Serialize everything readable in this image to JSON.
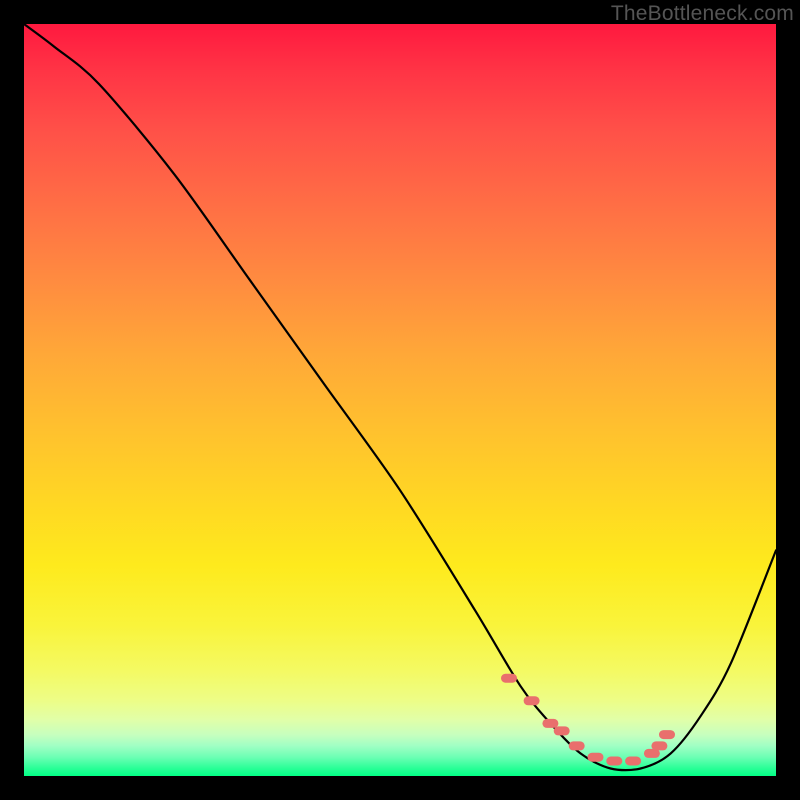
{
  "watermark": "TheBottleneck.com",
  "chart_data": {
    "type": "line",
    "title": "",
    "xlabel": "",
    "ylabel": "",
    "xlim": [
      0,
      100
    ],
    "ylim": [
      0,
      100
    ],
    "series": [
      {
        "name": "bottleneck-curve",
        "x": [
          0,
          4,
          10,
          20,
          30,
          40,
          50,
          60,
          66,
          70,
          74,
          78,
          82,
          86,
          90,
          94,
          100
        ],
        "values": [
          100,
          97,
          92,
          80,
          66,
          52,
          38,
          22,
          12,
          7,
          3,
          1,
          1,
          3,
          8,
          15,
          30
        ]
      }
    ],
    "markers": {
      "name": "highlight-dots",
      "color": "#e96f6d",
      "x": [
        64.5,
        67.5,
        70.0,
        71.5,
        73.5,
        76.0,
        78.5,
        81.0,
        83.5,
        84.5,
        85.5
      ],
      "values": [
        13.0,
        10.0,
        7.0,
        6.0,
        4.0,
        2.5,
        2.0,
        2.0,
        3.0,
        4.0,
        5.5
      ]
    },
    "gradient_stops": [
      {
        "pos": 0,
        "color": "#ff193f"
      },
      {
        "pos": 0.5,
        "color": "#ffc12e"
      },
      {
        "pos": 0.9,
        "color": "#edfd87"
      },
      {
        "pos": 1.0,
        "color": "#03ff86"
      }
    ]
  }
}
